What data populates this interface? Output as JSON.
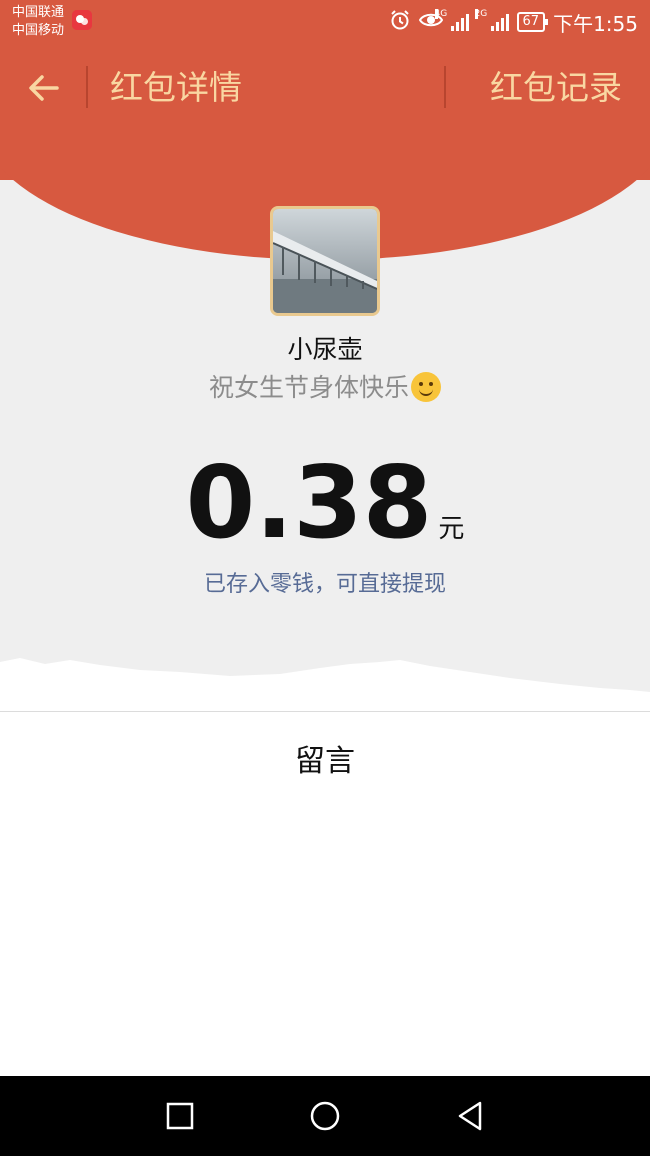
{
  "status_bar": {
    "carrier_1": "中国联通",
    "carrier_2": "中国移动",
    "network_1": "4G",
    "network_2": "2G",
    "battery": "67",
    "time": "下午1:55",
    "icons": [
      "alarm-icon",
      "eye-icon",
      "signal-icon",
      "battery-icon"
    ]
  },
  "nav": {
    "back_icon": "arrow-left-icon",
    "title": "红包详情",
    "record_link": "红包记录"
  },
  "packet": {
    "sender_name": "小尿壶",
    "greeting": "祝女生节身体快乐",
    "greeting_emoji": "smile-emoji-icon",
    "amount": "0.38",
    "unit": "元",
    "status_text": "已存入零钱，可直接提现"
  },
  "message_section": {
    "title": "留言"
  },
  "system_nav": {
    "buttons": [
      "recents-square-icon",
      "home-circle-icon",
      "back-triangle-icon"
    ]
  },
  "colors": {
    "header_red": "#d75940",
    "gold_text": "#f9d7a2",
    "link_blue": "#576b95",
    "background_gray": "#efefef"
  }
}
